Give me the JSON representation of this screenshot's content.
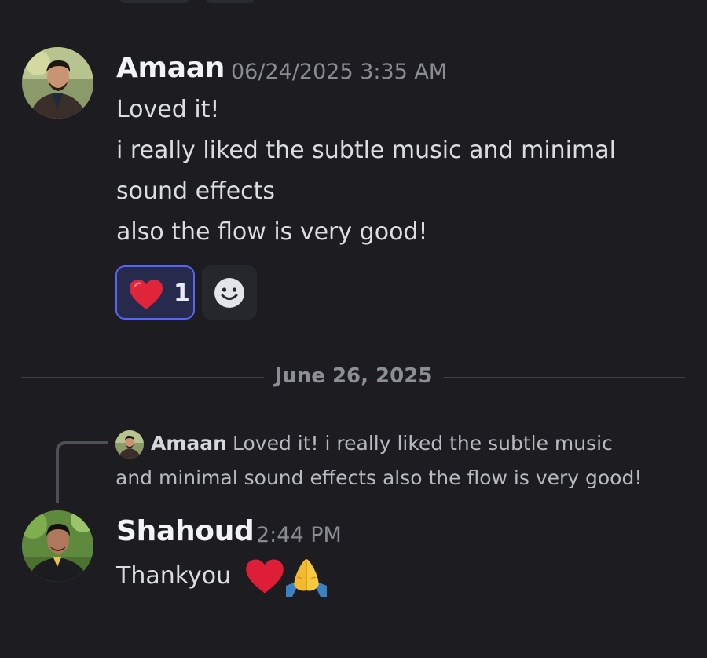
{
  "messages": [
    {
      "author": "Amaan",
      "timestamp": "06/24/2025 3:35 AM",
      "lines": [
        "Loved it!",
        "i really liked the subtle music and minimal",
        "sound effects",
        "also the flow is very good!"
      ],
      "reaction": {
        "emoji": "heart-emoji",
        "count": "1"
      }
    },
    {
      "author": "Shahoud",
      "timestamp": "2:44 PM",
      "text": "Thankyou",
      "emojis": [
        "heart-emoji",
        "folded-hands-emoji"
      ]
    }
  ],
  "divider": {
    "date": "June 26, 2025"
  },
  "reply": {
    "author": "Amaan",
    "line1": "Loved it!  i really liked the subtle music",
    "line2": "and minimal sound effects also the flow is very good!"
  },
  "colors": {
    "background": "#1c1c21",
    "reaction_border": "#5865f2",
    "reaction_bg": "#262a4c",
    "heart": "#e0243a",
    "divider": "#3f4147"
  }
}
